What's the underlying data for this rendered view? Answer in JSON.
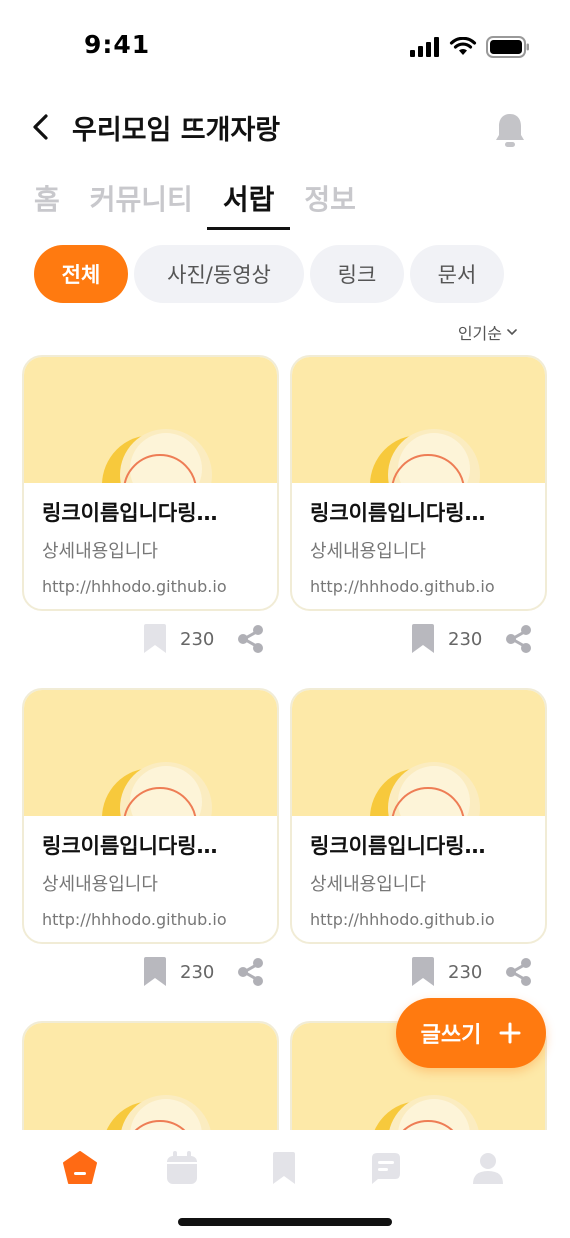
{
  "status_bar": {
    "time": "9:41"
  },
  "header": {
    "title": "우리모임 뜨개자랑"
  },
  "tabs": [
    {
      "label": "홈",
      "active": false
    },
    {
      "label": "커뮤니티",
      "active": false
    },
    {
      "label": "서랍",
      "active": true
    },
    {
      "label": "정보",
      "active": false
    }
  ],
  "filters": [
    {
      "label": "전체",
      "active": true
    },
    {
      "label": "사진/동영상",
      "active": false
    },
    {
      "label": "링크",
      "active": false
    },
    {
      "label": "문서",
      "active": false
    }
  ],
  "sort": {
    "label": "인기순"
  },
  "cards": [
    {
      "title": "링크이름입니다링…",
      "desc": "상세내용입니다",
      "url": "http://hhhodo.github.io",
      "count": "230",
      "bookmarked": false
    },
    {
      "title": "링크이름입니다링…",
      "desc": "상세내용입니다",
      "url": "http://hhhodo.github.io",
      "count": "230",
      "bookmarked": true
    },
    {
      "title": "링크이름입니다링…",
      "desc": "상세내용입니다",
      "url": "http://hhhodo.github.io",
      "count": "230",
      "bookmarked": true
    },
    {
      "title": "링크이름입니다링…",
      "desc": "상세내용입니다",
      "url": "http://hhhodo.github.io",
      "count": "230",
      "bookmarked": true
    }
  ],
  "fab": {
    "label": "글쓰기",
    "icon": "plus-icon"
  },
  "bottom_nav": [
    {
      "icon": "home-icon",
      "active": true
    },
    {
      "icon": "calendar-icon",
      "active": false
    },
    {
      "icon": "bookmark-icon",
      "active": false
    },
    {
      "icon": "chat-icon",
      "active": false
    },
    {
      "icon": "profile-icon",
      "active": false
    }
  ],
  "colors": {
    "accent": "#ff7a10",
    "thumb_bg": "#fde9a8",
    "chip_bg": "#f1f2f6",
    "icon_gray": "#c4c4c8"
  }
}
